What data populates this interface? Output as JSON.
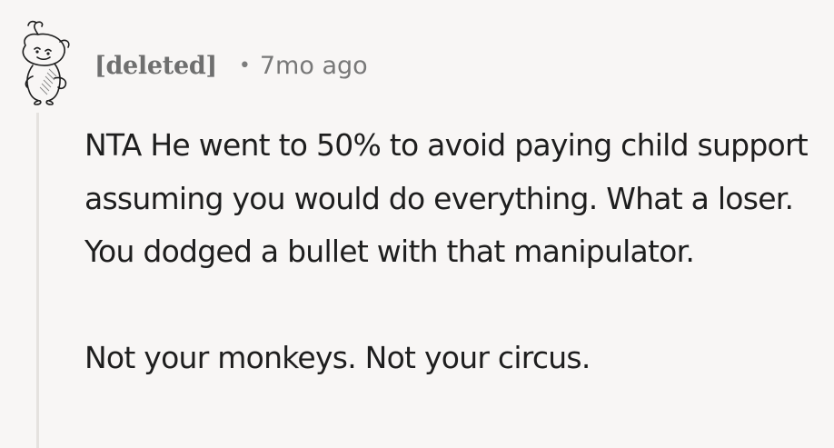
{
  "comment": {
    "author": "[deleted]",
    "separator": "•",
    "timestamp": "7mo ago",
    "paragraphs": [
      "NTA He went to 50% to avoid paying child support assuming you would do everything. What a loser. You dodged a bullet with that manipulator.",
      "Not your monkeys. Not your circus."
    ]
  },
  "icons": {
    "avatar": "snoo-avatar-icon"
  },
  "colors": {
    "background": "#f8f6f5",
    "author": "#6f6f6f",
    "timestamp": "#787878",
    "body_text": "#1e1e1e",
    "thread_line": "#e5e2df"
  }
}
